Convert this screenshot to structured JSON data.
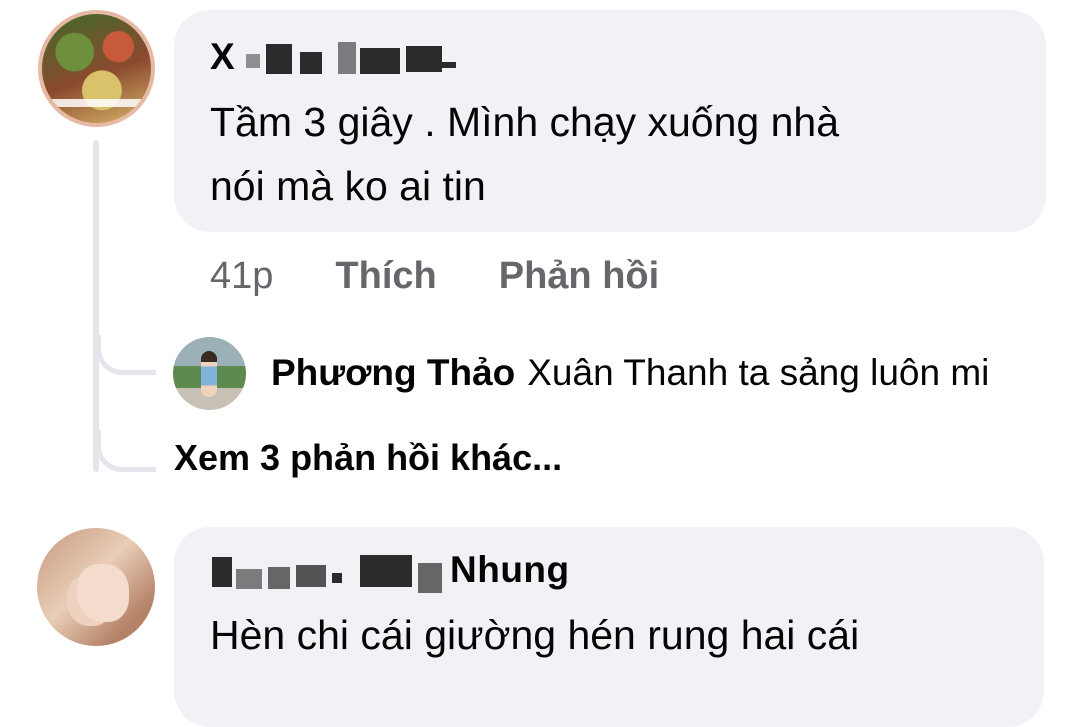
{
  "comment1": {
    "author_visible": "X",
    "text_line1": "Tầm 3 giây . Mình chạy xuống nhà",
    "text_line2": "nói mà ko ai tin",
    "time": "41p",
    "like_label": "Thích",
    "reply_label": "Phản hồi"
  },
  "reply": {
    "author": "Phương Thảo",
    "text": "Xuân Thanh ta sảng luôn mi"
  },
  "more_replies_label": "Xem 3 phản hồi khác...",
  "comment2": {
    "author_visible": "Nhung",
    "text_line1": "Hèn chi cái giường hén rung hai cái"
  },
  "colors": {
    "bubble": "#f0f2f5",
    "secondary_text": "#65676b",
    "thread_line": "#e4e6eb"
  }
}
